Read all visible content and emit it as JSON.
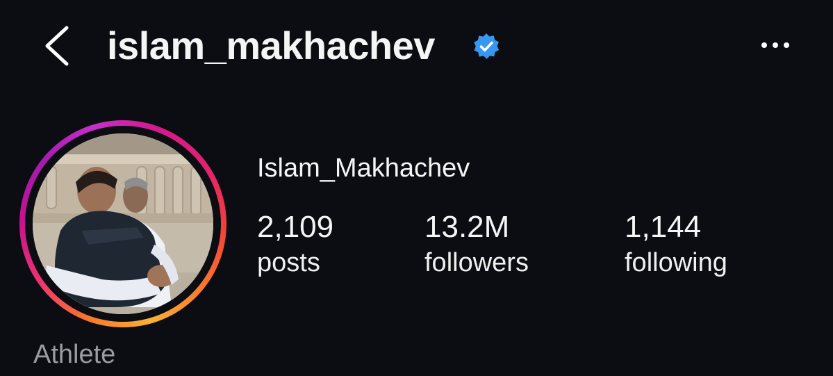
{
  "header": {
    "username": "islam_makhachev",
    "verified": true,
    "back_icon": "chevron-left-icon",
    "more_icon": "more-horizontal-icon",
    "badge_color": "#3897f0"
  },
  "profile": {
    "display_name": "Islam_Makhachev",
    "category": "Athlete",
    "story_ring_colors": [
      "#feda75",
      "#fa7e1e",
      "#d62976",
      "#962fbf"
    ]
  },
  "stats": [
    {
      "value": "2,109",
      "label": "posts"
    },
    {
      "value": "13.2M",
      "label": "followers"
    },
    {
      "value": "1,144",
      "label": "following"
    }
  ]
}
